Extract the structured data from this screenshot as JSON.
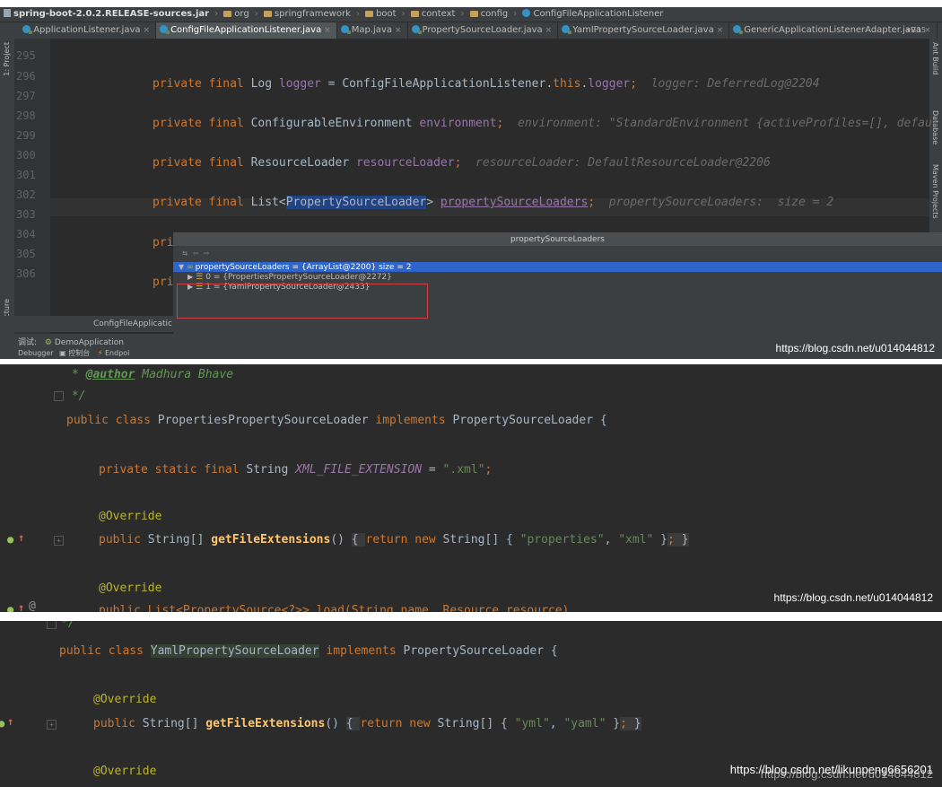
{
  "breadcrumb": [
    "spring-boot-2.0.2.RELEASE-sources.jar",
    "org",
    "springframework",
    "boot",
    "context",
    "config",
    "ConfigFileApplicationListener"
  ],
  "tabs": [
    {
      "label": "ApplicationListener.java",
      "active": false
    },
    {
      "label": "ConfigFileApplicationListener.java",
      "active": true
    },
    {
      "label": "Map.java",
      "active": false
    },
    {
      "label": "PropertySourceLoader.java",
      "active": false
    },
    {
      "label": "YamlPropertySourceLoader.java",
      "active": false
    },
    {
      "label": "GenericApplicationListenerAdapter.java",
      "active": false
    }
  ],
  "tab_close": "×",
  "tab_overflow": "▾☰15",
  "left_tools": {
    "project": "1: Project",
    "structure": "Z: Structure"
  },
  "right_tools": {
    "ant": "Ant Build",
    "database": "Database",
    "maven": "Maven Projects"
  },
  "panel1": {
    "lines": [
      "295",
      "296",
      "297",
      "298",
      "299",
      "300",
      "301",
      "302",
      "303",
      "304",
      "305",
      "306"
    ],
    "code296": {
      "a": "private final ",
      "b": "Log ",
      "c": "logger",
      "d": " = ConfigFileApplicationListener.",
      "e": "this",
      "f": ".",
      "g": "logger",
      "h": ";",
      "hint": "logger: DeferredLog@2204"
    },
    "code298": {
      "a": "private final ",
      "b": "ConfigurableEnvironment ",
      "c": "environment",
      "d": ";",
      "hint": "environment: \"StandardEnvironment {activeProfiles=[], defaul"
    },
    "code300": {
      "a": "private final ",
      "b": "ResourceLoader ",
      "c": "resourceLoader",
      "d": ";",
      "hint": "resourceLoader: DefaultResourceLoader@2206"
    },
    "code302": {
      "a": "private final ",
      "b": "List<",
      "c": "PropertySourceLoader",
      "d": "> ",
      "e": "propertySourceLoaders",
      "f": ";",
      "hint": "propertySourceLoaders:  size = 2"
    },
    "code304": "pri",
    "code306": "pri",
    "popup": {
      "title": "propertySourceLoaders",
      "tools": "⇆  ⇦  ⇨",
      "root": "propertySourceLoaders = {ArrayList@2200}  size = 2",
      "item0": "0 = {PropertiesPropertySourceLoader@2272}",
      "item1": "1 = {YamlPropertySourceLoader@2433}"
    },
    "bottom": {
      "file": "ConfigFileApplicatic",
      "debug": "调试:",
      "app": "DemoApplication",
      "debugger": "Debugger",
      "console": "控制台",
      "endpoints": "Endpoi"
    },
    "watermark": "https://blog.csdn.net/u014044812"
  },
  "panel2": {
    "author": {
      "star": "* ",
      "tag": "@author",
      "name": " Madhura Bhave"
    },
    "endcomment": " */",
    "classline": {
      "a": "public class ",
      "b": "PropertiesPropertySourceLoader",
      "c": " implements ",
      "d": "PropertySourceLoader {"
    },
    "field": {
      "a": "private static final ",
      "b": "String ",
      "c": "XML_FILE_EXTENSION",
      "d": " = ",
      "e": "\".xml\"",
      "f": ";"
    },
    "override1": "@Override",
    "method1": {
      "a": "public ",
      "b": "String[] ",
      "c": "getFileExtensions",
      "d": "() ",
      "e": "{ ",
      "f": "return new ",
      "g": "String[] { ",
      "h": "\"properties\"",
      "i": ", ",
      "j": "\"xml\"",
      "k": " }",
      "l": ";",
      "m": " }"
    },
    "override2": "@Override",
    "method2": "public List<PropertySource<?>> load(String name, Resource resource)",
    "watermark": "https://blog.csdn.net/u014044812"
  },
  "panel3": {
    "endcomment": "*/",
    "classline": {
      "a": "public class ",
      "b": "YamlPropertySourceLoader",
      "c": " implements ",
      "d": "PropertySourceLoader {"
    },
    "override1": "@Override",
    "method1": {
      "a": "public ",
      "b": "String[] ",
      "c": "getFileExtensions",
      "d": "() ",
      "e": "{ ",
      "f": "return new ",
      "g": "String[] { ",
      "h": "\"yml\"",
      "i": ", ",
      "j": "\"yaml\"",
      "k": " }",
      "l": ";",
      "m": " }"
    },
    "override2": "@Override",
    "watermark_a": "https://blog.csdn.net/likunpeng6656201",
    "watermark_b": "https://blog.csdn.net/u014044812"
  }
}
